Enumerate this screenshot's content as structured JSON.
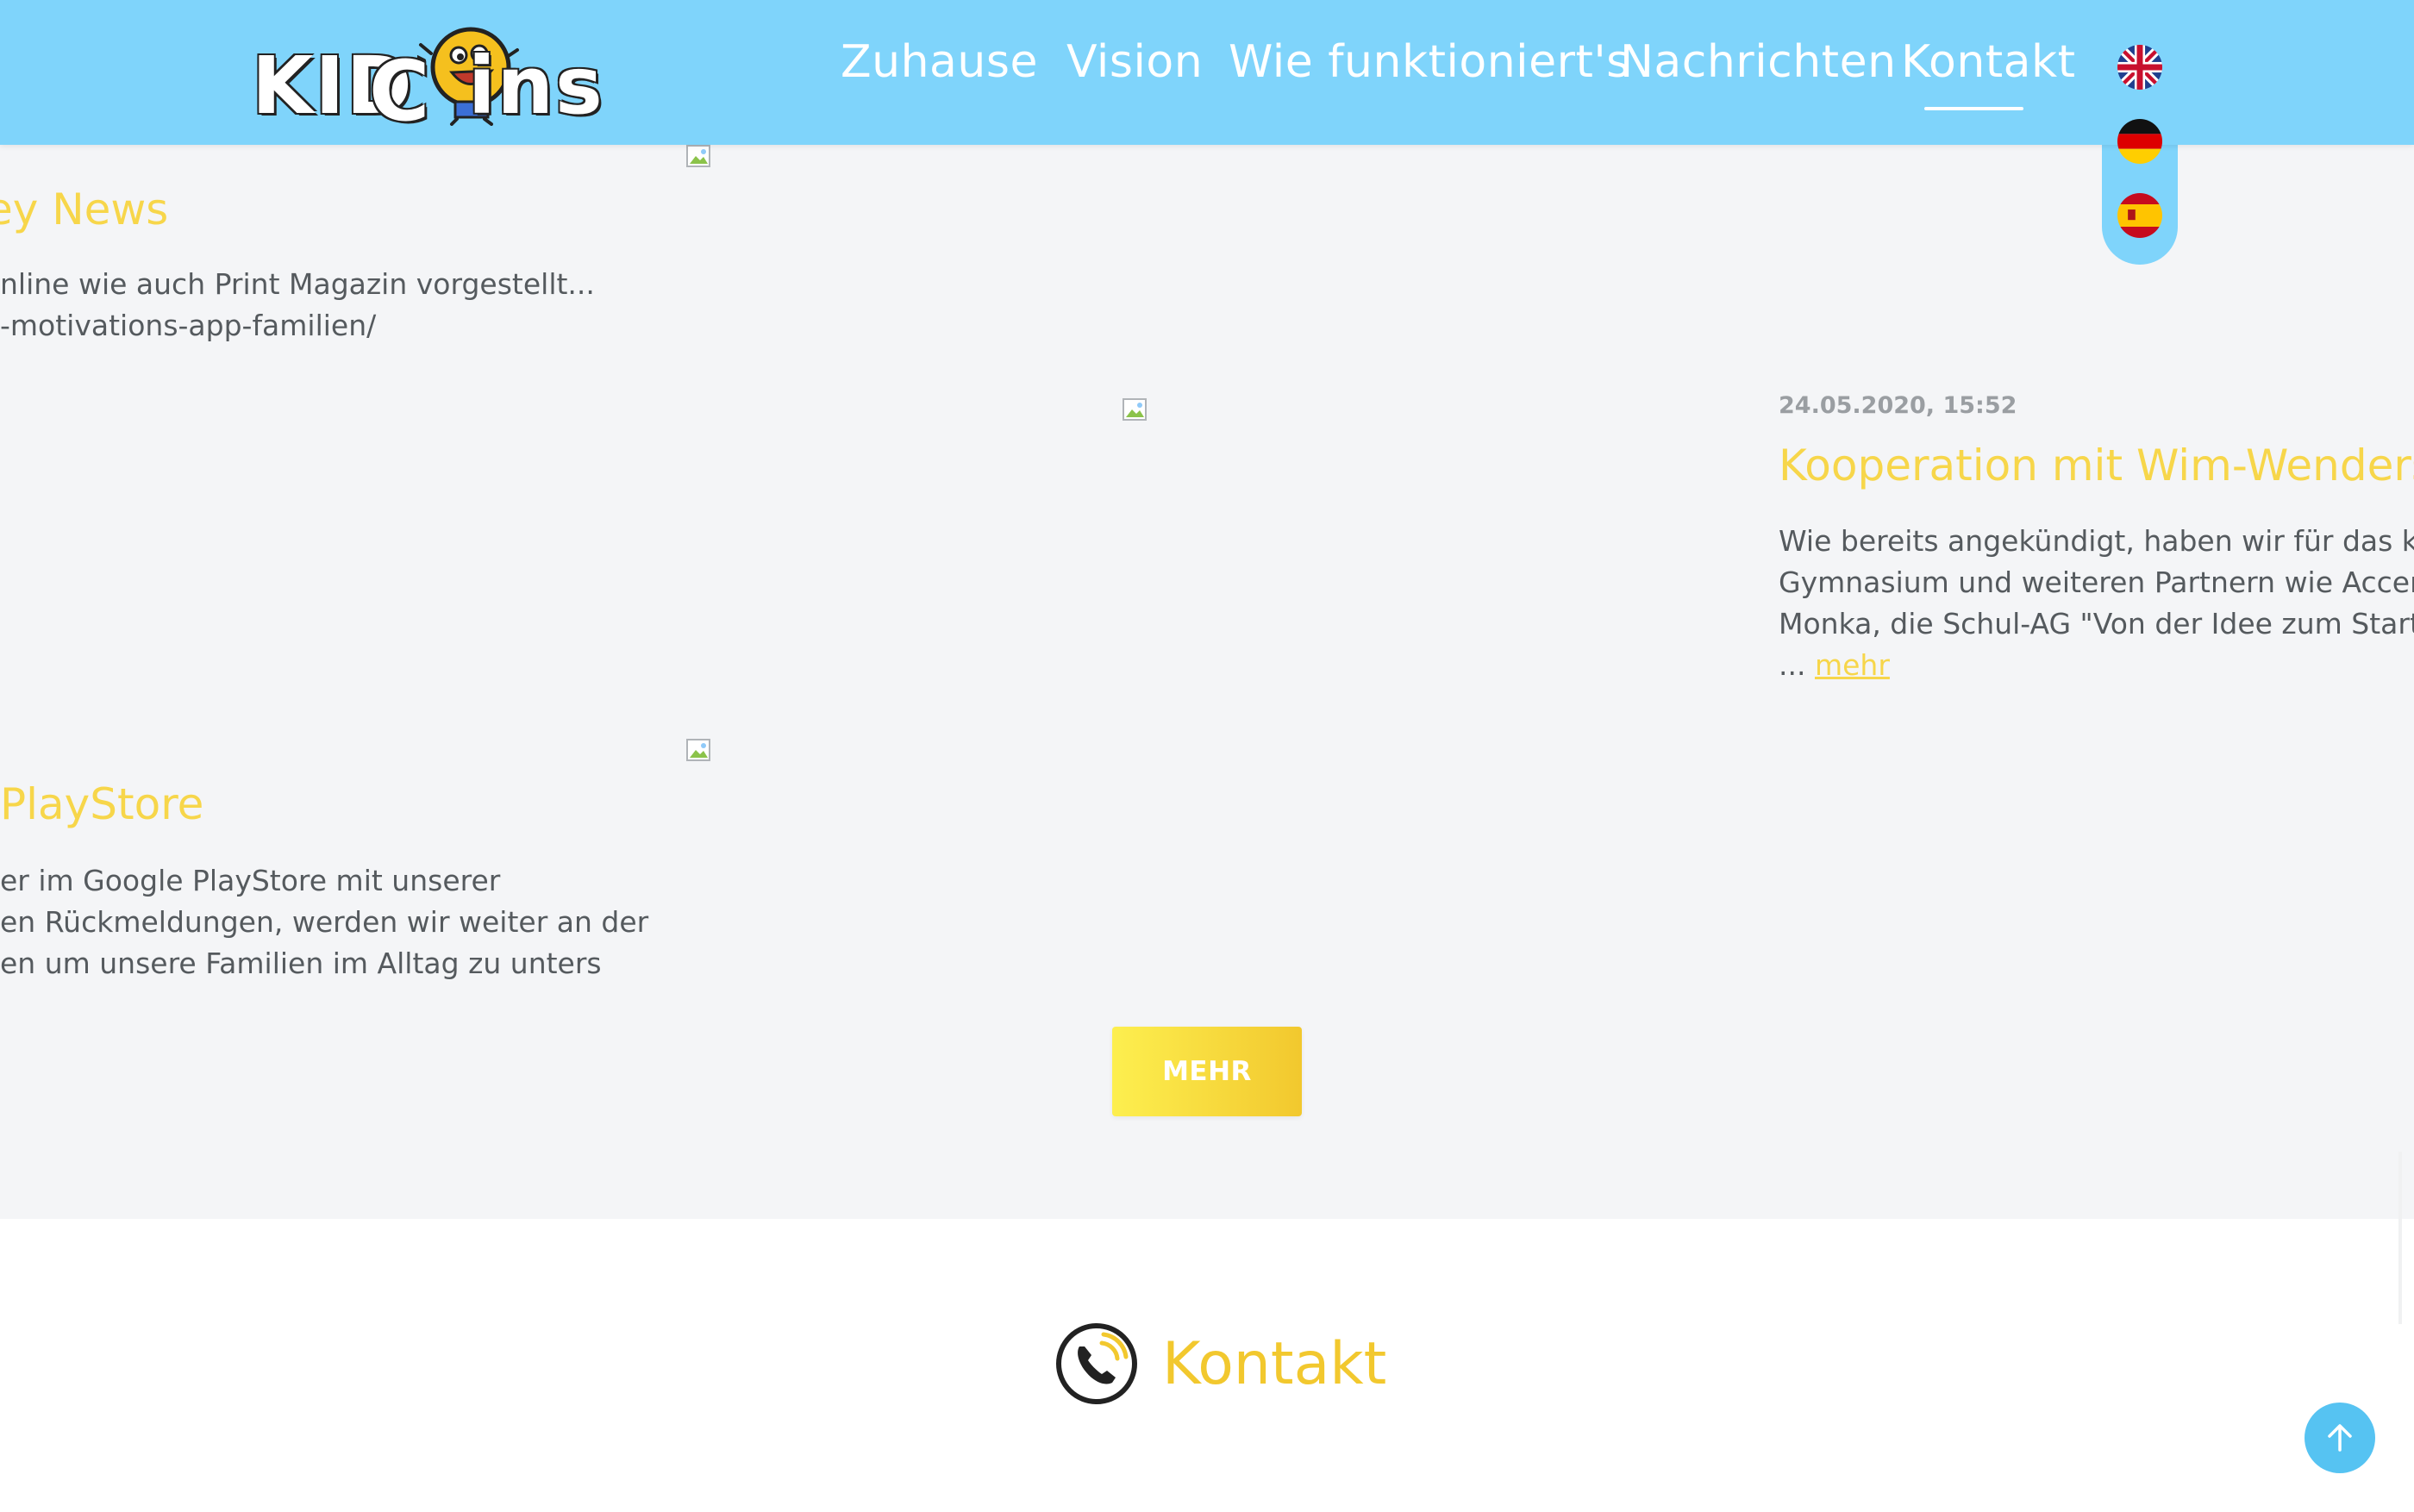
{
  "header": {
    "logo_text_left": "KID",
    "logo_text_c": "C",
    "logo_text_right": "ins",
    "nav": [
      {
        "label": "Zuhause"
      },
      {
        "label": "Vision"
      },
      {
        "label": "Wie funktioniert's"
      },
      {
        "label": "Nachrichten"
      },
      {
        "label": "Kontakt",
        "active": true
      }
    ],
    "languages": [
      {
        "flag": "uk-flag-icon"
      },
      {
        "flag": "germany-flag-icon"
      },
      {
        "flag": "spain-flag-icon"
      }
    ]
  },
  "news": {
    "posts": [
      {
        "title": "ey News",
        "lines": [
          "nline wie auch Print Magazin vorgestellt...",
          "-motivations-app-familien/"
        ]
      },
      {
        "date": "24.05.2020, 15:52",
        "title": "Kooperation mit Wim-Wenders G",
        "lines": [
          "Wie bereits angekündigt, haben wir für das kon",
          "Gymnasium und weiteren Partnern wie Accent",
          "Monka, die Schul-AG \"Von der Idee zum Start-u"
        ],
        "ellipsis": "...",
        "more_link": "mehr"
      },
      {
        "title": "PlayStore",
        "lines": [
          "er im Google PlayStore mit unserer",
          "en Rückmeldungen, werden wir weiter an der",
          "en um unsere Familien im Alltag zu unters"
        ]
      }
    ],
    "more_button": "MEHR"
  },
  "contact": {
    "title": "Kontakt"
  },
  "colors": {
    "header_bg": "#7fd4fb",
    "accent_yellow": "#f7d64a",
    "button_gradient": [
      "#fdef4f",
      "#f2c82e"
    ],
    "scroll_top": "#56c3f2"
  }
}
